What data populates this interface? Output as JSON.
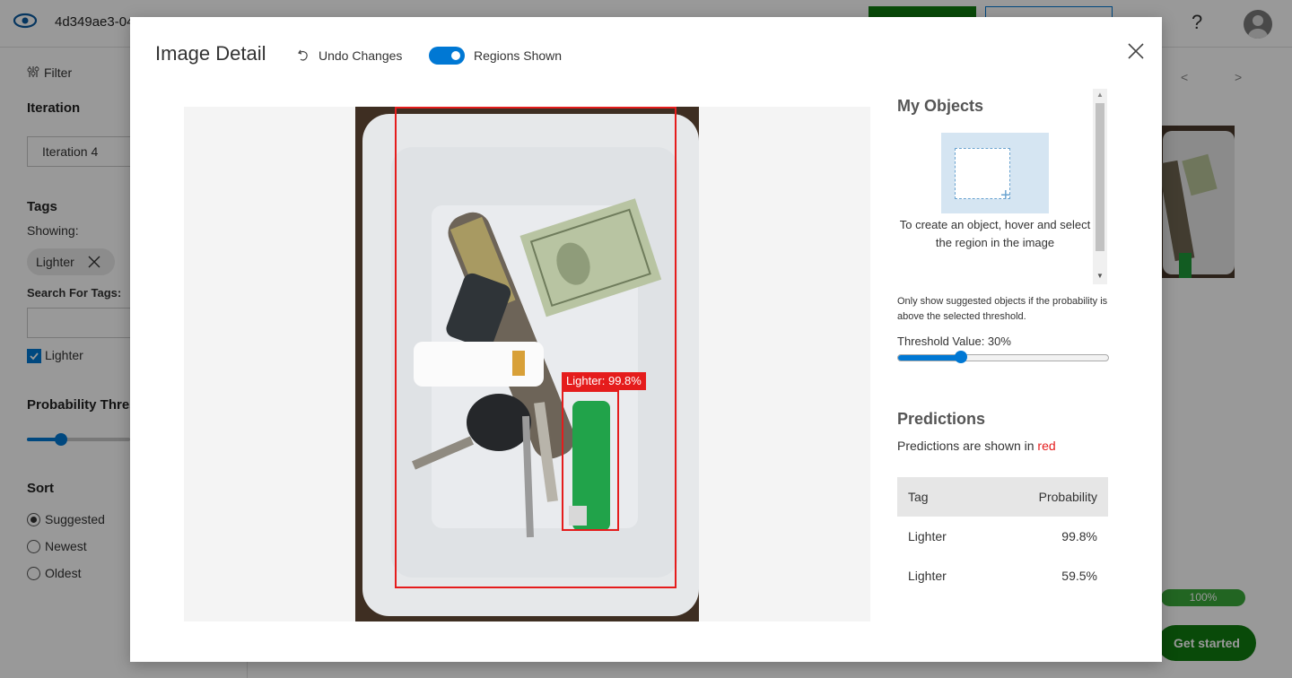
{
  "app": {
    "project_id": "4d349ae3-04",
    "help_label": "?"
  },
  "sidebar": {
    "filter_label": "Filter",
    "iteration_heading": "Iteration",
    "iteration_value": "Iteration 4",
    "tags_heading": "Tags",
    "showing_label": "Showing:",
    "tag_chip": "Lighter",
    "search_tags_label": "Search For Tags:",
    "checkbox_label": "Lighter",
    "probability_heading": "Probability Thres",
    "sort_heading": "Sort",
    "sort_options": [
      "Suggested",
      "Newest",
      "Oldest"
    ]
  },
  "background": {
    "progress_label": "100%",
    "get_started_label": "Get started",
    "prev_arrow": "<",
    "next_arrow": ">"
  },
  "modal": {
    "title": "Image Detail",
    "undo_label": "Undo Changes",
    "regions_label": "Regions Shown",
    "regions_shown": true,
    "region_label": "Lighter: 99.8%",
    "my_objects_heading": "My Objects",
    "create_hint": "To create an object, hover and select the region in the image",
    "threshold_note": "Only show suggested objects if the probability is above the selected threshold.",
    "threshold_label": "Threshold Value: 30%",
    "threshold_value": 0.3,
    "predictions_heading": "Predictions",
    "predictions_note_prefix": "Predictions are shown in ",
    "predictions_note_color": "red",
    "table_headers": [
      "Tag",
      "Probability"
    ],
    "predictions": [
      {
        "tag": "Lighter",
        "probability": "99.8%"
      },
      {
        "tag": "Lighter",
        "probability": "59.5%"
      }
    ]
  },
  "colors": {
    "accent": "#0078d4",
    "region": "#e51c1c",
    "success": "#107c10"
  }
}
